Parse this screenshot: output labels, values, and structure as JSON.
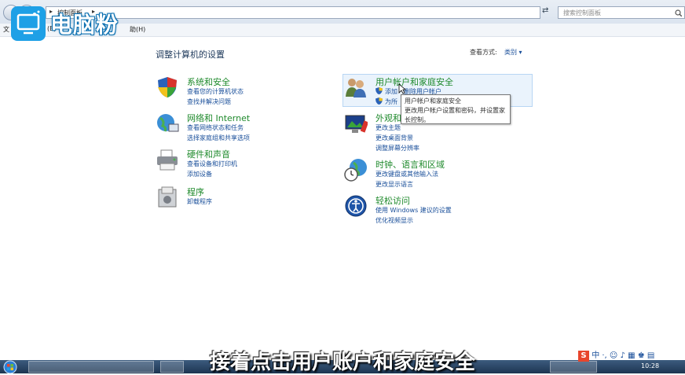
{
  "window": {
    "address_path": "控制面板",
    "search_placeholder": "搜索控制面板",
    "menu": [
      "文",
      "(E)",
      "助(H)"
    ]
  },
  "watermark": {
    "logo_text": "电脑粉"
  },
  "page": {
    "title": "调整计算机的设置",
    "view_by_label": "查看方式:",
    "view_by_value": "类别 ▾"
  },
  "categories_left": [
    {
      "name": "system-security",
      "icon": "shield-icon",
      "title": "系统和安全",
      "links": [
        "查看您的计算机状态",
        "查找并解决问题"
      ]
    },
    {
      "name": "network-internet",
      "icon": "globe-network-icon",
      "title": "网络和 Internet",
      "links": [
        "查看网络状态和任务",
        "选择家庭组和共享选项"
      ]
    },
    {
      "name": "hardware-sound",
      "icon": "printer-icon",
      "title": "硬件和声音",
      "links": [
        "查看设备和打印机",
        "添加设备"
      ]
    },
    {
      "name": "programs",
      "icon": "programs-icon",
      "title": "程序",
      "links": [
        "卸载程序"
      ]
    }
  ],
  "categories_right": [
    {
      "name": "user-accounts",
      "icon": "users-icon",
      "title": "用户帐户和家庭安全",
      "links": [
        "添加",
        "删除用户帐户",
        "为所"
      ]
    },
    {
      "name": "appearance",
      "icon": "monitor-icon",
      "title": "外观和",
      "links": [
        "更改主题",
        "更改桌面背景",
        "调整屏幕分辨率"
      ]
    },
    {
      "name": "clock-language",
      "icon": "clock-globe-icon",
      "title": "时钟、语言和区域",
      "links": [
        "更改键盘或其他输入法",
        "更改显示语言"
      ]
    },
    {
      "name": "ease-access",
      "icon": "ease-access-icon",
      "title": "轻松访问",
      "links": [
        "使用 Windows 建议的设置",
        "优化视频显示"
      ]
    }
  ],
  "tooltip": {
    "title": "用户帐户和家庭安全",
    "body": "更改用户帐户设置和密码，并设置家长控制。"
  },
  "subtitle": "接着点击用户账户和家庭安全",
  "taskbar": {
    "clock": "10:28"
  },
  "colors": {
    "category_title": "#1f8a2c",
    "link": "#1a4f9a",
    "logo_blue": "#1ea0e6"
  }
}
